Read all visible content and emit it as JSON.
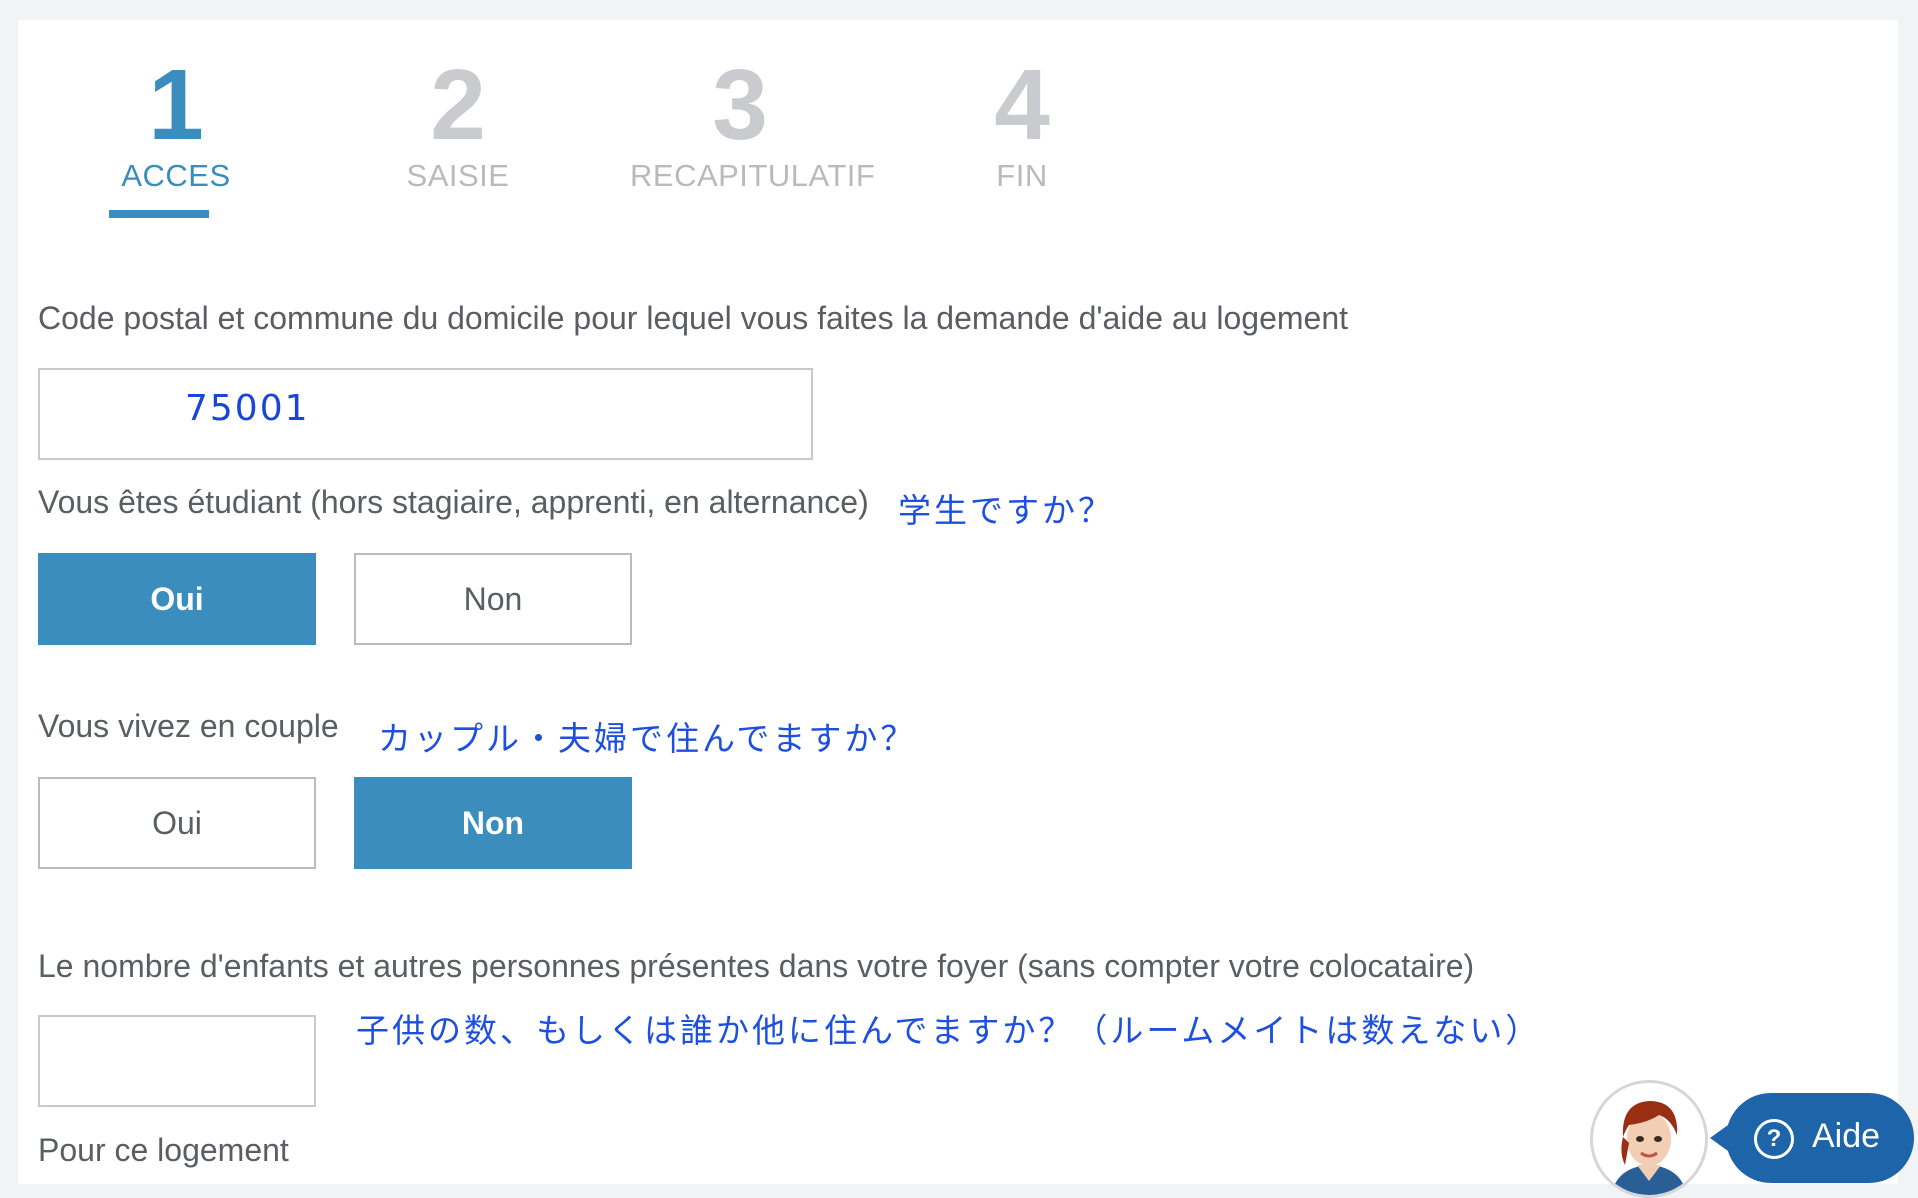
{
  "steps": [
    {
      "num": "1",
      "label": "ACCES",
      "active": true
    },
    {
      "num": "2",
      "label": "SAISIE",
      "active": false
    },
    {
      "num": "3",
      "label": "RECAPITULATIF",
      "active": false
    },
    {
      "num": "4",
      "label": "FIN",
      "active": false
    }
  ],
  "postal": {
    "label": "Code postal et commune du domicile pour lequel vous faites la demande d'aide au logement",
    "value": "75001"
  },
  "student": {
    "label": "Vous êtes étudiant (hors stagiaire, apprenti, en alternance)",
    "note": "学生ですか？",
    "yes": "Oui",
    "no": "Non",
    "selected": "yes"
  },
  "couple": {
    "label": "Vous vivez en couple",
    "note": "カップル・夫婦で住んでますか？",
    "yes": "Oui",
    "no": "Non",
    "selected": "no"
  },
  "household": {
    "label": "Le nombre d'enfants et autres personnes présentes dans votre foyer (sans compter votre colocataire)",
    "note": "子供の数、もしくは誰か他に住んでますか？（ルームメイトは数えない）",
    "value": ""
  },
  "housing": {
    "label": "Pour ce logement"
  },
  "help": {
    "label": "Aide",
    "icon": "question-circle-icon",
    "color": "#1e64a8"
  },
  "colors": {
    "accent": "#3b8dbd",
    "annotation": "#1d4fe0"
  }
}
